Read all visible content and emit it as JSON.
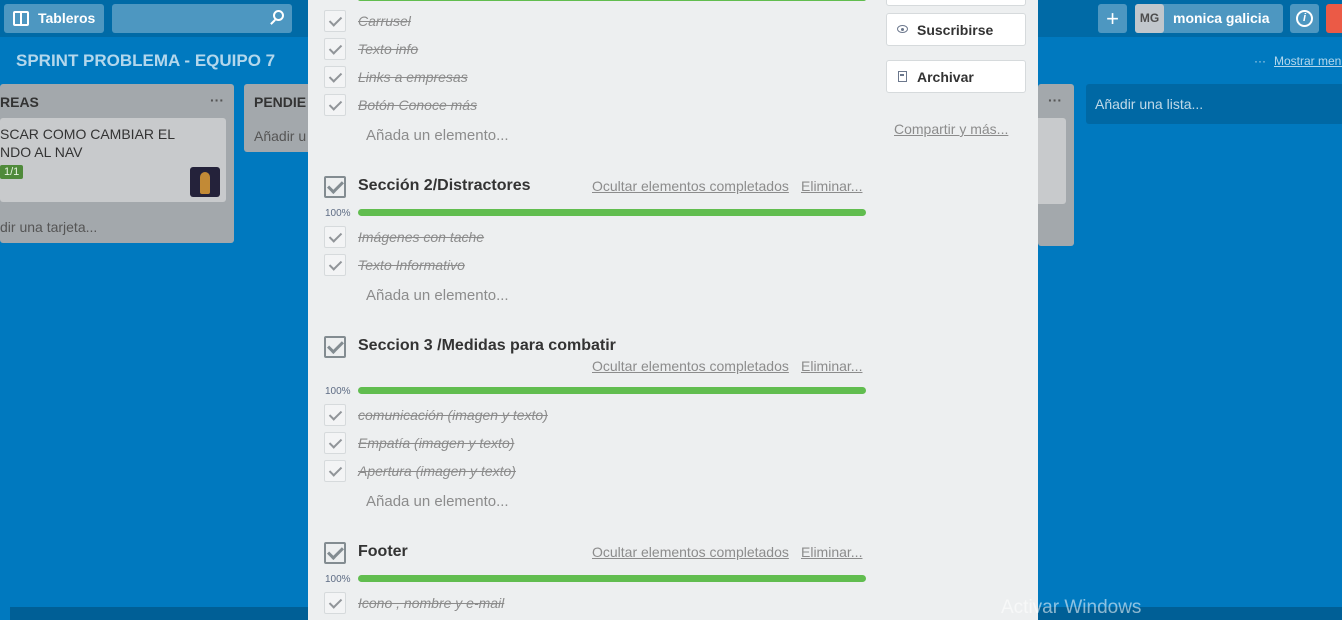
{
  "topbar": {
    "boards_label": "Tableros",
    "add_label": "+",
    "user_initials": "MG",
    "user_name": "monica galicia",
    "info_label": "i"
  },
  "board": {
    "title": "SPRINT PROBLEMA - EQUIPO 7",
    "menu_dots": "···",
    "menu_label": "Mostrar menú",
    "lists": [
      {
        "name": "REAS",
        "menu": "···",
        "card_text": "SCAR COMO CAMBIAR EL\nNDO AL NAV",
        "card_badge": "1/1",
        "add_card": "dir una tarjeta..."
      },
      {
        "name": "PENDIE",
        "add_card": "Añadir u"
      },
      {
        "menu": "···"
      }
    ],
    "add_list": "Añadir una lista..."
  },
  "modal": {
    "checklists": [
      {
        "items": [
          "Carrusel",
          "Texto info",
          "Links a empresas",
          "Botón Conoce más"
        ],
        "add_item": "Añada un elemento..."
      },
      {
        "title": "Sección 2/Distractores",
        "hide": "Ocultar elementos completados",
        "delete": "Eliminar...",
        "percent": "100%",
        "progress": 1.0,
        "items": [
          "Imágenes con tache",
          "Texto Informativo"
        ],
        "add_item": "Añada un elemento..."
      },
      {
        "title": "Seccion 3 /Medidas para combatir",
        "hide": "Ocultar elementos completados",
        "delete": "Eliminar...",
        "percent": "100%",
        "progress": 1.0,
        "items": [
          "comunicación (imagen y texto)",
          "Empatía (imagen y texto)",
          "Apertura (imagen y texto)"
        ],
        "add_item": "Añada un elemento..."
      },
      {
        "title": "Footer",
        "hide": "Ocultar elementos completados",
        "delete": "Eliminar...",
        "percent": "100%",
        "progress": 1.0,
        "items": [
          "Icono , nombre y e-mail"
        ]
      }
    ],
    "sidebar": {
      "subscribe_label": "Suscribirse",
      "archive_label": "Archivar",
      "share_label": "Compartir y más..."
    }
  },
  "watermark": "Activar Windows",
  "colors": {
    "board_bg": "#0079bf",
    "progress_green": "#61bd4f",
    "modal_bg": "#edeff0",
    "label_green": "#4f8a3a"
  }
}
